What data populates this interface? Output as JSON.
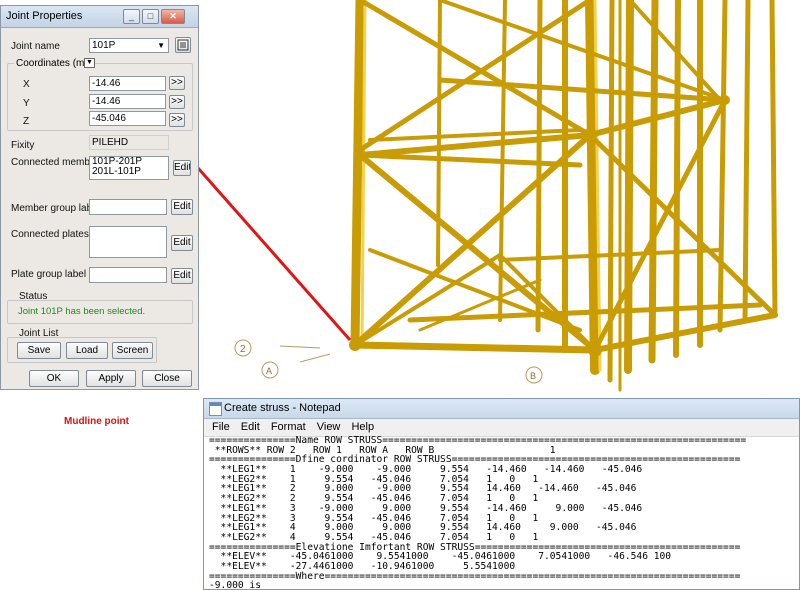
{
  "jointProps": {
    "title": "Joint Properties",
    "jointNameLabel": "Joint name",
    "jointName": "101P",
    "coordsLabel": "Coordinates (m)",
    "xLabel": "X",
    "x": "-14.46",
    "yLabel": "Y",
    "y": "-14.46",
    "zLabel": "Z",
    "z": "-45.046",
    "arrowBtn": ">>",
    "fixityLabel": "Fixity",
    "fixity": "PILEHD",
    "connectedMembersLabel": "Connected members",
    "connectedMembers": [
      "101P-201P",
      "201L-101P"
    ],
    "memberGroupLabel": "Member group label",
    "connectedPlatesLabel": "Connected plates",
    "plateGroupLabel": "Plate group label",
    "editBtn": "Edit",
    "statusLabel": "Status",
    "statusText": "Joint 101P has been selected.",
    "jointListLabel": "Joint List",
    "saveBtn": "Save",
    "loadBtn": "Load",
    "screenBtn": "Screen",
    "okBtn": "OK",
    "applyBtn": "Apply",
    "closeBtn": "Close"
  },
  "annotation": {
    "mudline": "Mudline point"
  },
  "scene": {
    "label2": "2",
    "labelA": "A",
    "labelB": "B"
  },
  "notepad": {
    "title": "Create struss - Notepad",
    "menu": [
      "File",
      "Edit",
      "Format",
      "View",
      "Help"
    ],
    "lines": [
      "===============Name ROW STRUSS===============================================================",
      " **ROWS** ROW 2   ROW 1   ROW A   ROW B                    1",
      "===============Dfine cordinator ROW STRUSS==================================================",
      "  **LEG1**    1    -9.000    -9.000     9.554   -14.460   -14.460   -45.046",
      "  **LEG2**    1     9.554   -45.046     7.054   1   0   1",
      "  **LEG1**    2     9.000    -9.000     9.554   14.460   -14.460   -45.046",
      "  **LEG2**    2     9.554   -45.046     7.054   1   0   1",
      "  **LEG1**    3    -9.000     9.000     9.554   -14.460     9.000   -45.046",
      "  **LEG2**    3     9.554   -45.046     7.054   1   0   1",
      "  **LEG1**    4     9.000     9.000     9.554   14.460     9.000   -45.046",
      "  **LEG2**    4     9.554   -45.046     7.054   1   0   1",
      "===============Elevatione Imfortant ROW STRUSS==============================================",
      "  **ELEV**    -45.0461000    9.5541000    -45.0461000    7.0541000   -46.546 100",
      "  **ELEV**    -27.4461000   -10.9461000     5.5541000",
      "===============Where========================================================================",
      "-9.000 is"
    ]
  }
}
